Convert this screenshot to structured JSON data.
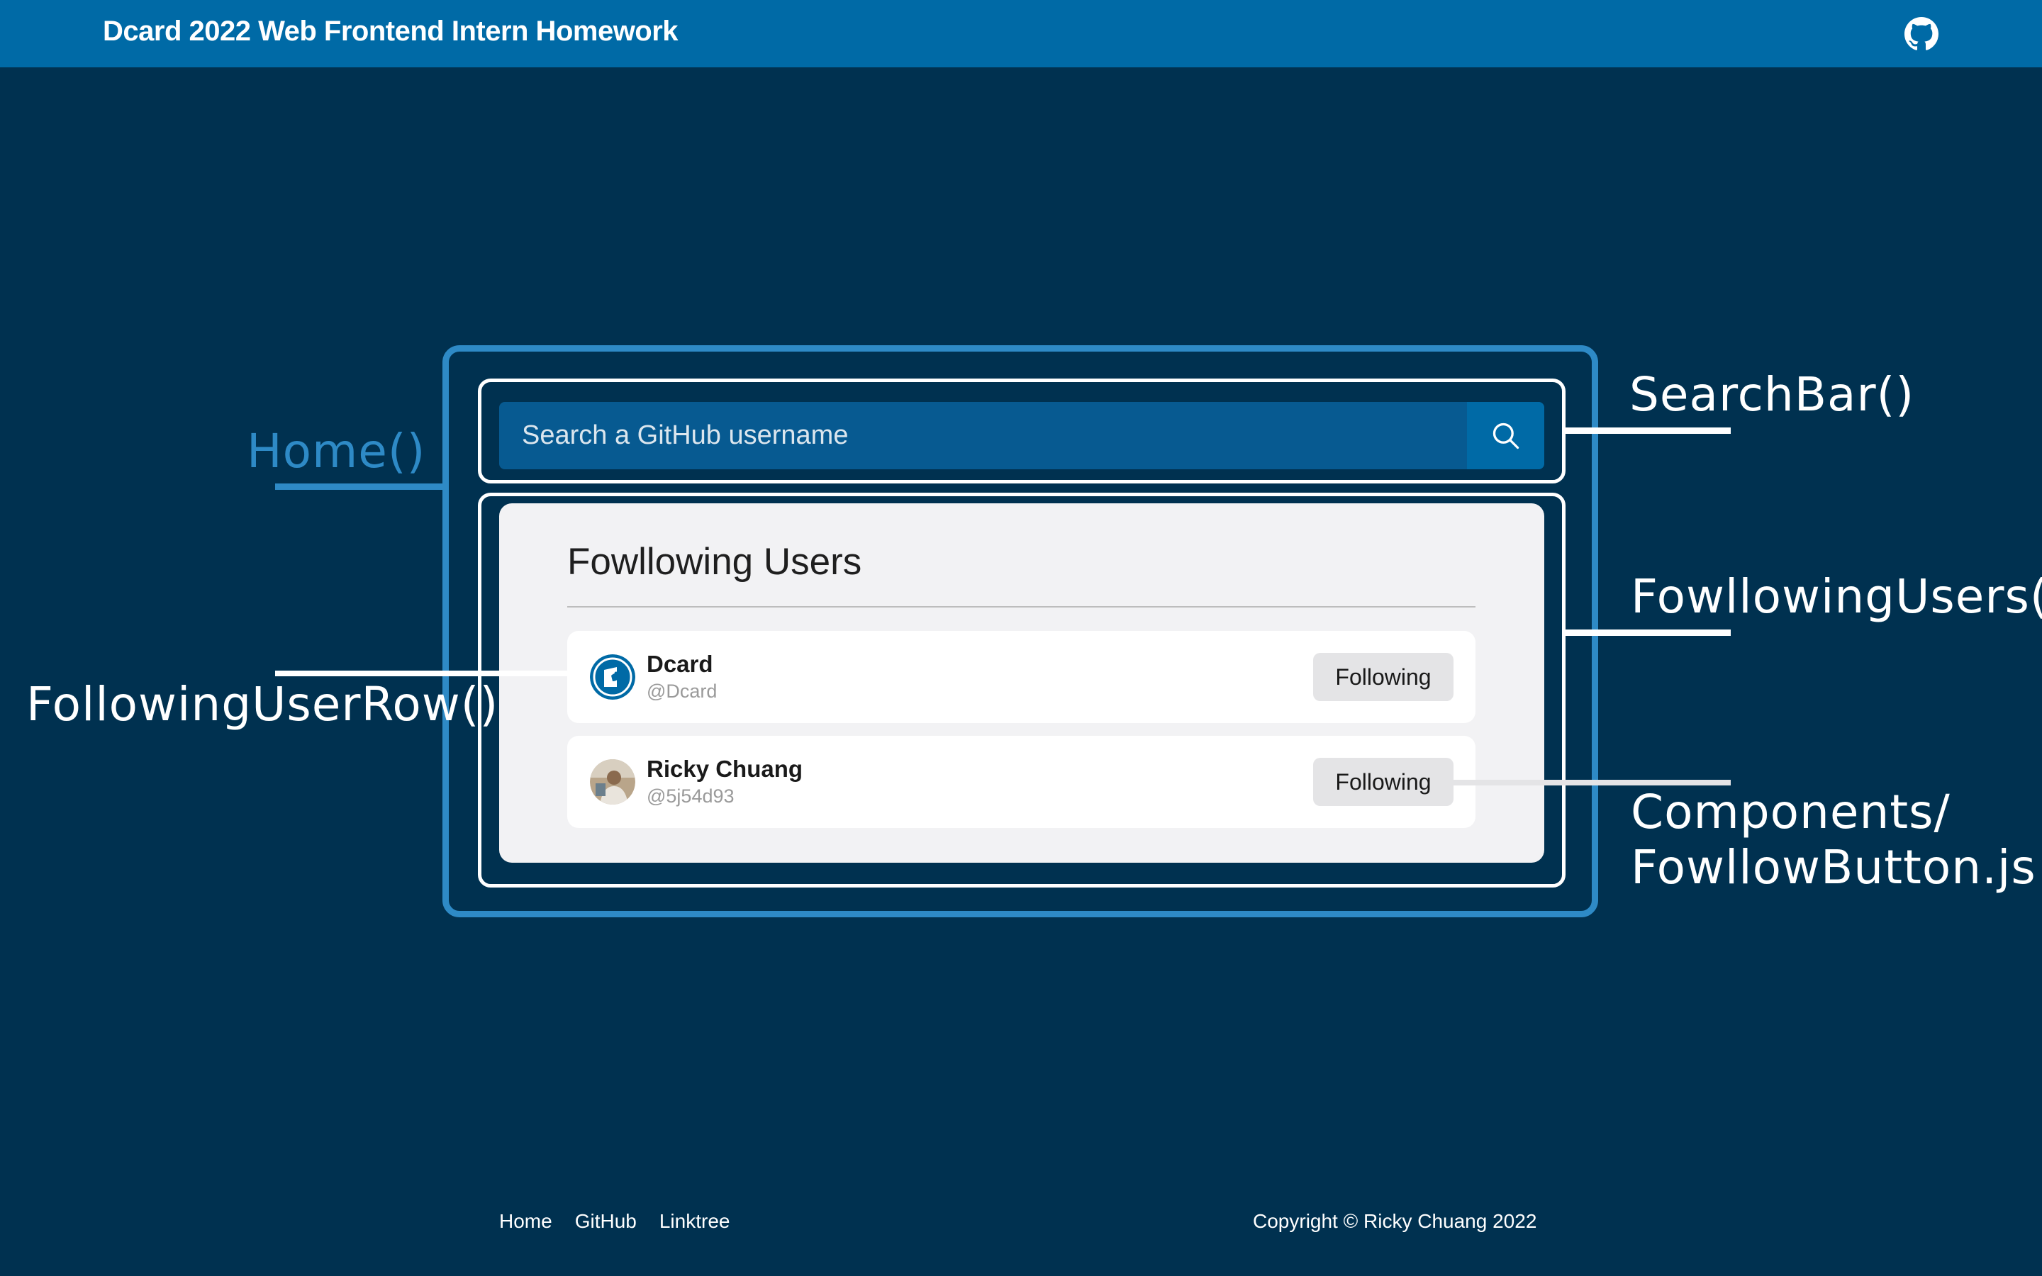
{
  "header": {
    "title": "Dcard 2022 Web Frontend Intern Homework",
    "github_icon": "github-icon"
  },
  "search": {
    "placeholder": "Search a GitHub username",
    "button_icon": "search-icon"
  },
  "following": {
    "title": "Fowllowing Users",
    "users": [
      {
        "name": "Dcard",
        "handle": "@Dcard",
        "button_label": "Following",
        "avatar": "dcard-logo-avatar"
      },
      {
        "name": "Ricky Chuang",
        "handle": "@5j54d93",
        "button_label": "Following",
        "avatar": "user-photo-avatar"
      }
    ]
  },
  "annotations": {
    "home": "Home()",
    "searchbar": "SearchBar()",
    "following_users": "FowllowingUsers()",
    "following_user_row": "FollowingUserRow()",
    "follow_button_line1": "Components/",
    "follow_button_line2": "FowllowButton.js"
  },
  "footer": {
    "links": [
      "Home",
      "GitHub",
      "Linktree"
    ],
    "copyright": "Copyright © Ricky Chuang 2022"
  },
  "colors": {
    "background": "#003150",
    "header": "#006AA6",
    "accent": "#2E8AC6",
    "search_bar": "#075A91",
    "card": "#F2F2F4",
    "follow_button": "#E4E4E6"
  }
}
